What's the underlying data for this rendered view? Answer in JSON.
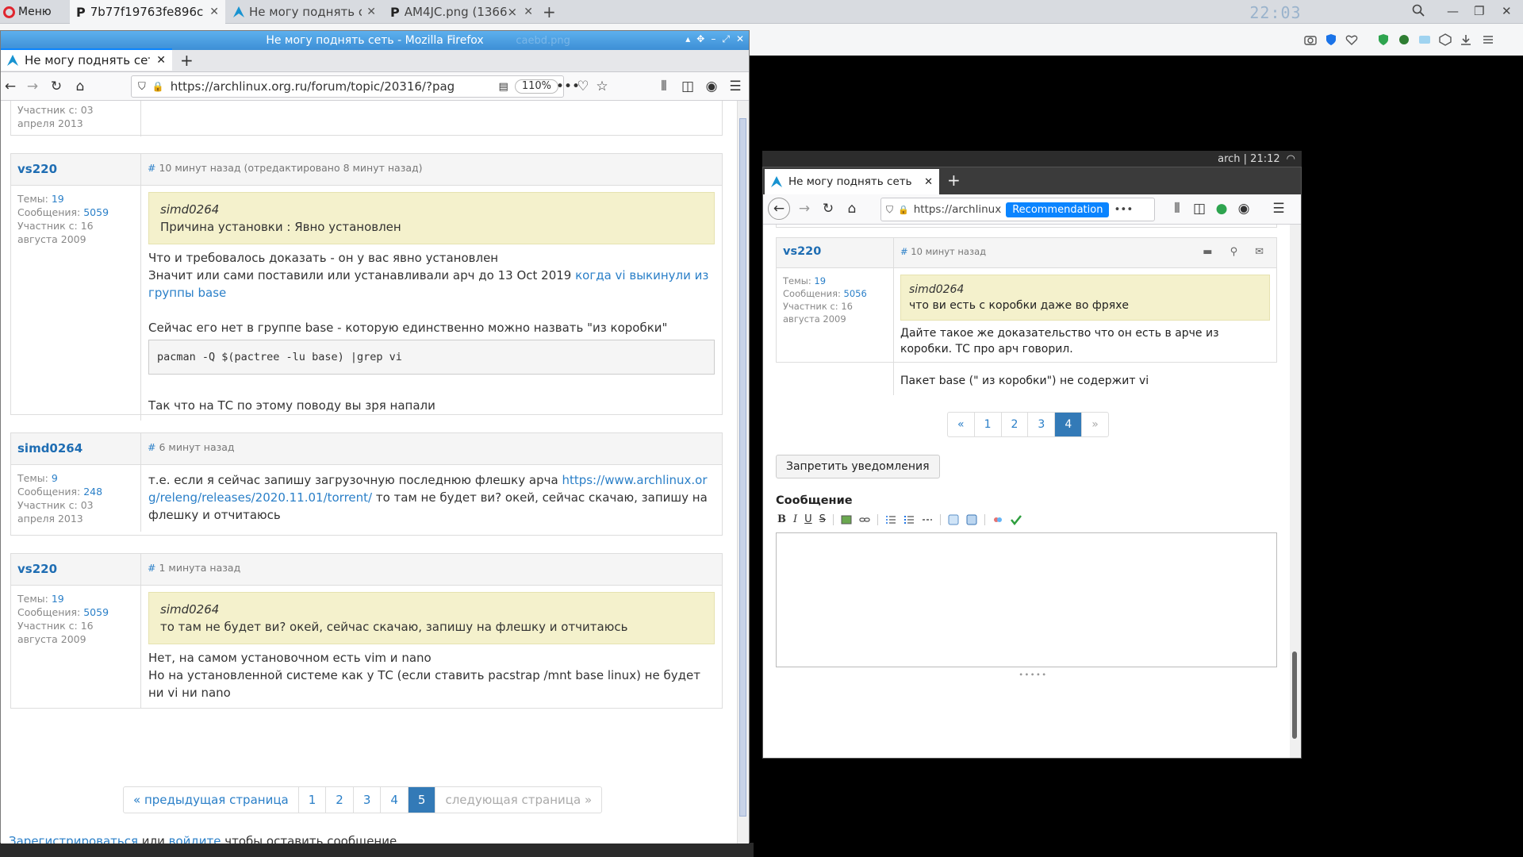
{
  "opera": {
    "menu_label": "Меню",
    "tabs": [
      {
        "title": "7b77f19763fe896c",
        "favicon": "P"
      },
      {
        "title": "Не могу поднять се",
        "favicon": "arch"
      },
      {
        "title": "AM4JC.png (1366×",
        "favicon": "P"
      }
    ],
    "clock": "22:03",
    "accent": "#e0262f"
  },
  "w1": {
    "window_title": "Не могу поднять сеть - Mozilla Firefox",
    "ghost_path": "/f/",
    "ghost_file": "caebd.png",
    "tab_title": "Не могу поднять сеть",
    "url": "https://archlinux.org.ru/forum/topic/20316/?pag",
    "zoom": "110%",
    "top_side_snippet": [
      "Участник с: 03",
      "апреля 2013"
    ],
    "posts": [
      {
        "author": "vs220",
        "hash": "#",
        "time": "10 минут назад (отредактировано 8 минут назад)",
        "topics_label": "Темы:",
        "topics": "19",
        "msgs_label": "Сообщения:",
        "msgs": "5059",
        "since": [
          "Участник с: 16",
          "августа 2009"
        ],
        "quote_author": "simd0264",
        "quote_text": "Причина установки : Явно установлен",
        "lines": [
          "Что и требовалось доказать - он у вас явно установлен",
          "Значит или сами поставили или устанавливали арч до 13 Oct 2019 "
        ],
        "link_text": "когда vi выкинули из группы base",
        "line3": "Сейчас его нет в группе base - которую единственно можно назвать \"из коробки\"",
        "code": "pacman -Q $(pactree -lu base) |grep vi",
        "line4": "Так что на ТС по этому поводу вы зря напали"
      },
      {
        "author": "simd0264",
        "hash": "#",
        "time": "6 минут назад",
        "topics_label": "Темы:",
        "topics": "9",
        "msgs_label": "Сообщения:",
        "msgs": "248",
        "since": [
          "Участник с: 03",
          "апреля 2013"
        ],
        "text_before": "т.е. если я сейчас запишу загрузочную последнюю флешку арча ",
        "link_text": "https://www.archlinux.org/releng/releases/2020.11.01/torrent/",
        "text_after": " то там не будет ви? окей, сейчас скачаю, запишу на флешку и отчитаюсь"
      },
      {
        "author": "vs220",
        "hash": "#",
        "time": "1 минута назад",
        "topics_label": "Темы:",
        "topics": "19",
        "msgs_label": "Сообщения:",
        "msgs": "5059",
        "since": [
          "Участник с: 16",
          "августа 2009"
        ],
        "quote_author": "simd0264",
        "quote_text": "то там не будет ви? окей, сейчас скачаю, запишу на флешку и отчитаюсь",
        "lines": [
          "Нет, на самом установочном есть vim и nano",
          "Но на установленной системе как у ТС (если ставить pacstrap /mnt base linux) не будет ни vi ни nano"
        ]
      }
    ],
    "pager": {
      "prev": "« предыдущая страница",
      "pages": [
        "1",
        "2",
        "3",
        "4",
        "5"
      ],
      "active": "5",
      "next": "следующая страница »"
    },
    "footer": {
      "register": "Зарегистрироваться",
      "or": " или ",
      "login": "войдите",
      "tail": " чтобы оставить сообщение."
    }
  },
  "w2": {
    "status": "arch  |  21:12",
    "tab_title": "Не могу поднять сеть",
    "url": "https://archlinux",
    "recommendation": "Recommendation",
    "post": {
      "author": "vs220",
      "hash": "#",
      "time": "10 минут назад",
      "topics_label": "Темы:",
      "topics": "19",
      "msgs_label": "Сообщения:",
      "msgs": "5056",
      "since": [
        "Участник с: 16",
        "августа 2009"
      ],
      "quote_author": "simd0264",
      "quote_text": "что ви есть с коробки даже во фряхе",
      "line1": "Дайте такое же доказательство что он есть в арче из коробки. ТС про арч говорил.",
      "line2": "Пакет base (\" из коробки\") не содержит vi"
    },
    "pager": {
      "prev": "«",
      "pages": [
        "1",
        "2",
        "3",
        "4"
      ],
      "active": "4",
      "next": "»"
    },
    "mute_button": "Запретить уведомления",
    "message_label": "Сообщение",
    "editor": {
      "bold": "B",
      "italic": "I",
      "underline": "U",
      "strike": "S"
    }
  }
}
